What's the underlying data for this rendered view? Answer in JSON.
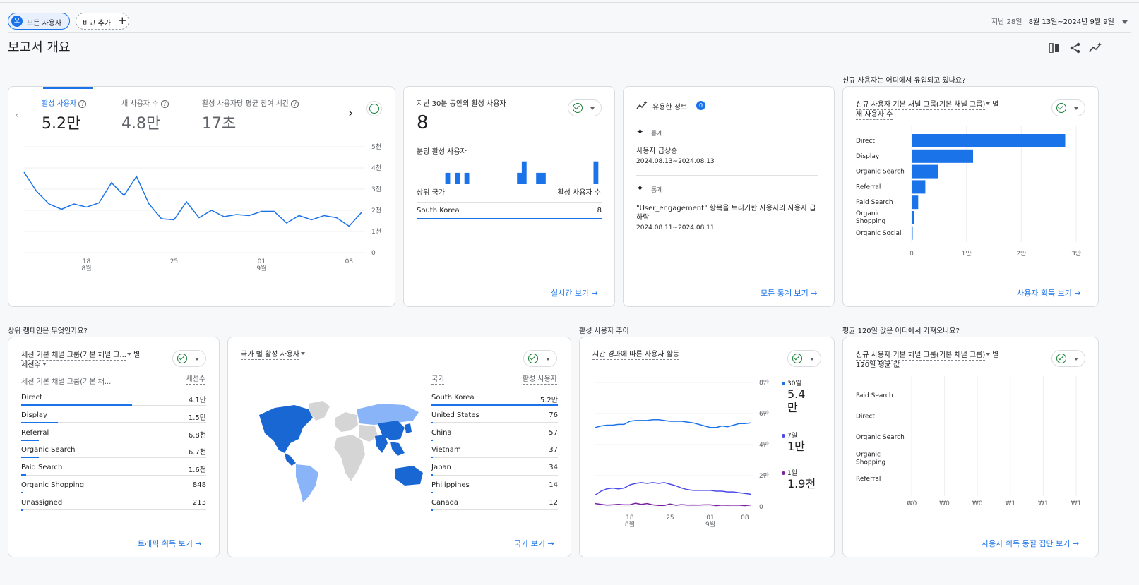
{
  "top_bar": {
    "segment_badge": "모",
    "segment_label": "모든 사용자",
    "compare_label": "비교 추가",
    "date_prefix": "지난 28일",
    "date_range": "8월 13일~2024년 9월 9일"
  },
  "page_title": "보고서 개요",
  "section_titles": {
    "new_users_where": "신규 사용자는 어디에서 유입되고 있나요?",
    "top_campaigns": "상위 캠페인은 무엇인가요?",
    "active_trend": "활성 사용자 추이",
    "ltv_where": "평균 120일 값은 어디에서 가져오나요?"
  },
  "kpi_card": {
    "metrics": [
      {
        "label": "활성 사용자",
        "value": "5.2만"
      },
      {
        "label": "새 사용자 수",
        "value": "4.8만"
      },
      {
        "label": "활성 사용자당 평균 참여 시간",
        "value": "17초"
      }
    ],
    "y_ticks": [
      "5천",
      "4천",
      "3천",
      "2천",
      "1천",
      "0"
    ],
    "x_ticks": [
      {
        "day": "18",
        "month": "8월"
      },
      {
        "day": "25",
        "month": ""
      },
      {
        "day": "01",
        "month": "9월"
      },
      {
        "day": "08",
        "month": ""
      }
    ],
    "series": [
      3800,
      2900,
      2300,
      2050,
      2300,
      2150,
      2350,
      3300,
      2700,
      3600,
      2300,
      1600,
      1550,
      2400,
      1650,
      2000,
      1700,
      1800,
      1750,
      1950,
      1950,
      1400,
      1750,
      1550,
      1750,
      1650,
      1250,
      1900
    ]
  },
  "realtime_card": {
    "title": "지난 30분 동안의 활성 사용자",
    "value": "8",
    "per_minute_label": "분당 활성 사용자",
    "per_minute": [
      0,
      0,
      0,
      0,
      0,
      0,
      1,
      0,
      1,
      0,
      1,
      0,
      0,
      0,
      0,
      0,
      0,
      0,
      0,
      0,
      0,
      1,
      2,
      0,
      0,
      1,
      1,
      0,
      0,
      0,
      0,
      0,
      0,
      0,
      0,
      0,
      0,
      2,
      0
    ],
    "col_country": "상위 국가",
    "col_users": "활성 사용자 수",
    "rows": [
      {
        "name": "South Korea",
        "value": "8"
      }
    ],
    "link": "실시간 보기"
  },
  "insights_card": {
    "title": "유용한 정보",
    "badge": "0",
    "items": [
      {
        "kind": "통계",
        "text": "사용자 급상승",
        "date": "2024.08.13~2024.08.13"
      },
      {
        "kind": "통계",
        "text": "\"User_engagement\" 항목을 트리거한 사용자의 사용자 급하락",
        "date": "2024.08.11~2024.08.11"
      }
    ],
    "link": "모든 통계 보기"
  },
  "acquisition_card": {
    "title": "신규 사용자 기본 채널 그룹(기본 채널 그룹)",
    "title_suffix": "별",
    "subtitle": "새 사용자 수",
    "categories": [
      "Direct",
      "Display",
      "Organic Search",
      "Referral",
      "Paid Search",
      "Organic Shopping",
      "Organic Social"
    ],
    "values": [
      28000,
      11200,
      4800,
      2500,
      1200,
      500,
      100
    ],
    "x_ticks": [
      "0",
      "1만",
      "2만",
      "3만"
    ],
    "xmax": 30000,
    "link": "사용자 획득 보기"
  },
  "sessions_card": {
    "title": "세션 기본 채널 그룹(기본 채널 그...",
    "title_suffix": "별",
    "subtitle": "세션수",
    "col_channel": "세션 기본 채널 그룹(기본 채...",
    "col_sessions": "세션수",
    "rows": [
      {
        "name": "Direct",
        "value": "4.1만",
        "frac": 0.6
      },
      {
        "name": "Display",
        "value": "1.5만",
        "frac": 0.2
      },
      {
        "name": "Referral",
        "value": "6.8천",
        "frac": 0.095
      },
      {
        "name": "Organic Search",
        "value": "6.7천",
        "frac": 0.095
      },
      {
        "name": "Paid Search",
        "value": "1.6천",
        "frac": 0.025
      },
      {
        "name": "Organic Shopping",
        "value": "848",
        "frac": 0.012
      },
      {
        "name": "Unassigned",
        "value": "213",
        "frac": 0.004
      }
    ],
    "link": "트래픽 획득 보기"
  },
  "country_card": {
    "title": "국가 별 활성 사용자",
    "col_country": "국가",
    "col_users": "활성 사용자",
    "rows": [
      {
        "name": "South Korea",
        "value": "5.2만",
        "frac": 1.0
      },
      {
        "name": "United States",
        "value": "76",
        "frac": 0.01
      },
      {
        "name": "China",
        "value": "57",
        "frac": 0.008
      },
      {
        "name": "Vietnam",
        "value": "37",
        "frac": 0.006
      },
      {
        "name": "Japan",
        "value": "34",
        "frac": 0.005
      },
      {
        "name": "Philippines",
        "value": "14",
        "frac": 0.003
      },
      {
        "name": "Canada",
        "value": "12",
        "frac": 0.002
      }
    ],
    "link": "국가 보기"
  },
  "trend_card": {
    "title": "시간 경과에 따른 사용자 활동",
    "y_ticks": [
      "8만",
      "6만",
      "4만",
      "2만",
      "0"
    ],
    "x_ticks": [
      {
        "day": "18",
        "month": "8월"
      },
      {
        "day": "25",
        "month": ""
      },
      {
        "day": "01",
        "month": "9월"
      },
      {
        "day": "08",
        "month": ""
      }
    ],
    "legend": [
      {
        "label": "30일",
        "value": "5.4",
        "value2": "만",
        "color": "#1a73e8"
      },
      {
        "label": "7일",
        "value": "1만",
        "value2": "",
        "color": "#4a4ae8"
      },
      {
        "label": "1일",
        "value": "1.9천",
        "value2": "",
        "color": "#7b1fa2"
      }
    ],
    "series30": [
      51000,
      52000,
      52500,
      52500,
      53000,
      53000,
      55000,
      55500,
      55500,
      55500,
      56000,
      56000,
      55500,
      55000,
      55000,
      55000,
      54500,
      54000,
      53000,
      52000,
      51000,
      51000,
      52000,
      51500,
      52500,
      53500,
      53500,
      54000
    ],
    "series7": [
      7500,
      10000,
      11500,
      12000,
      11500,
      12000,
      14000,
      15000,
      15500,
      15000,
      15500,
      15000,
      15500,
      14500,
      13500,
      12000,
      11000,
      10500,
      10500,
      10500,
      10500,
      10000,
      10000,
      9500,
      9500,
      9000,
      8500,
      8000
    ],
    "series1": [
      2000,
      1500,
      1000,
      1200,
      1500,
      1200,
      1200,
      2200,
      1500,
      2000,
      1200,
      800,
      800,
      1700,
      900,
      1300,
      1000,
      1100,
      1000,
      1200,
      1200,
      700,
      1000,
      900,
      1000,
      950,
      700,
      1100
    ],
    "ymax": 80000
  },
  "ltv_card": {
    "title": "신규 사용자 기본 채널 그룹(기본 채널 그룹)",
    "title_suffix": "별",
    "subtitle": "120일 평균 값",
    "categories": [
      "Paid Search",
      "Direct",
      "Organic Search",
      "Organic Shopping",
      "Referral"
    ],
    "x_ticks": [
      "₩0",
      "₩0",
      "₩0",
      "₩1",
      "₩1",
      "₩1"
    ],
    "link": "사용자 획득 동질 집단 보기"
  },
  "colors": {
    "accent": "#1a73e8",
    "light_blue": "#8ab4f8",
    "purple": "#7b1fa2"
  }
}
